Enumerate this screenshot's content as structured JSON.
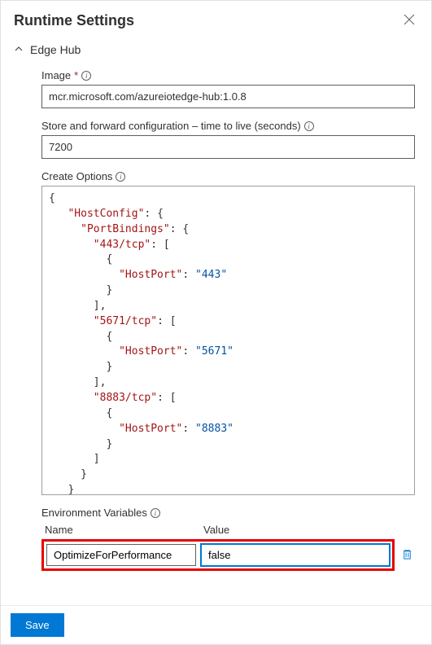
{
  "header": {
    "title": "Runtime Settings"
  },
  "section": {
    "title": "Edge Hub"
  },
  "image_field": {
    "label": "Image",
    "value": "mcr.microsoft.com/azureiotedge-hub:1.0.8"
  },
  "ttl_field": {
    "label": "Store and forward configuration – time to live (seconds)",
    "value": "7200"
  },
  "create_options": {
    "label": "Create Options",
    "json": {
      "root_key": "HostConfig",
      "bindings_key": "PortBindings",
      "ports": [
        {
          "port": "443/tcp",
          "host_key": "HostPort",
          "host_value": "443"
        },
        {
          "port": "5671/tcp",
          "host_key": "HostPort",
          "host_value": "5671"
        },
        {
          "port": "8883/tcp",
          "host_key": "HostPort",
          "host_value": "8883"
        }
      ]
    }
  },
  "env_vars": {
    "label": "Environment Variables",
    "col_name": "Name",
    "col_value": "Value",
    "row": {
      "name": "OptimizeForPerformance",
      "value": "false"
    }
  },
  "footer": {
    "save_label": "Save"
  }
}
